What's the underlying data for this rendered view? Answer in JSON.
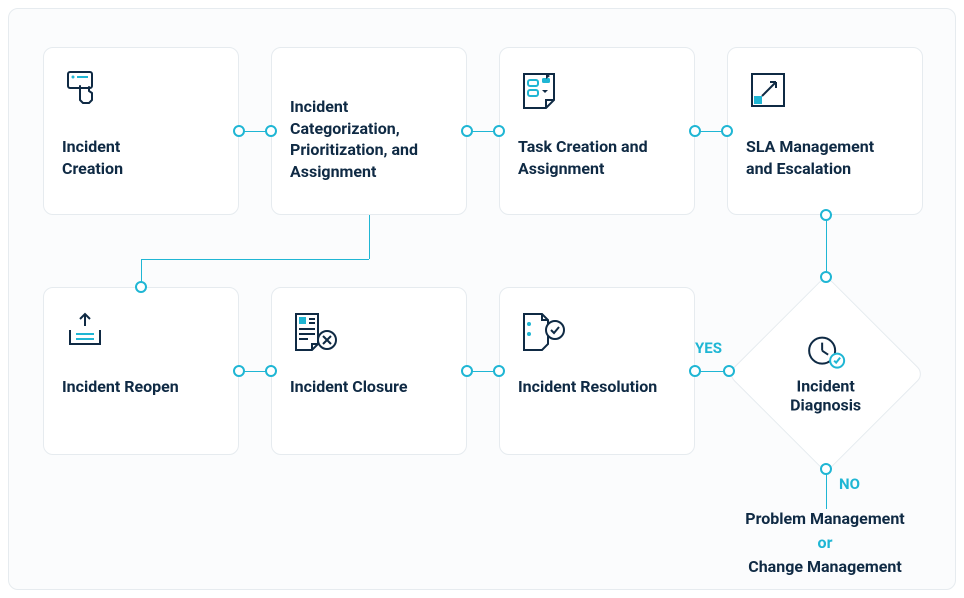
{
  "diagram": {
    "boxes": {
      "creation": {
        "label": "Incident\nCreation"
      },
      "categorization": {
        "label": "Incident Categorization, Prioritization, and Assignment"
      },
      "task": {
        "label": "Task Creation and Assignment"
      },
      "sla": {
        "label": "SLA Management and Escalation"
      },
      "reopen": {
        "label": "Incident Reopen"
      },
      "closure": {
        "label": "Incident Closure"
      },
      "resolution": {
        "label": "Incident Resolution"
      }
    },
    "decision": {
      "label": "Incident\nDiagnosis"
    },
    "edges": {
      "yes": "YES",
      "no": "NO"
    },
    "outcome": {
      "line1": "Problem Management",
      "or": "or",
      "line2": "Change Management"
    }
  },
  "icons": {
    "creation": "finger-pointer-icon",
    "categorization": "",
    "task": "task-board-icon",
    "sla": "arrow-box-icon",
    "reopen": "upload-tray-icon",
    "closure": "document-x-icon",
    "resolution": "document-check-icon",
    "diagnosis": "clock-check-icon"
  }
}
